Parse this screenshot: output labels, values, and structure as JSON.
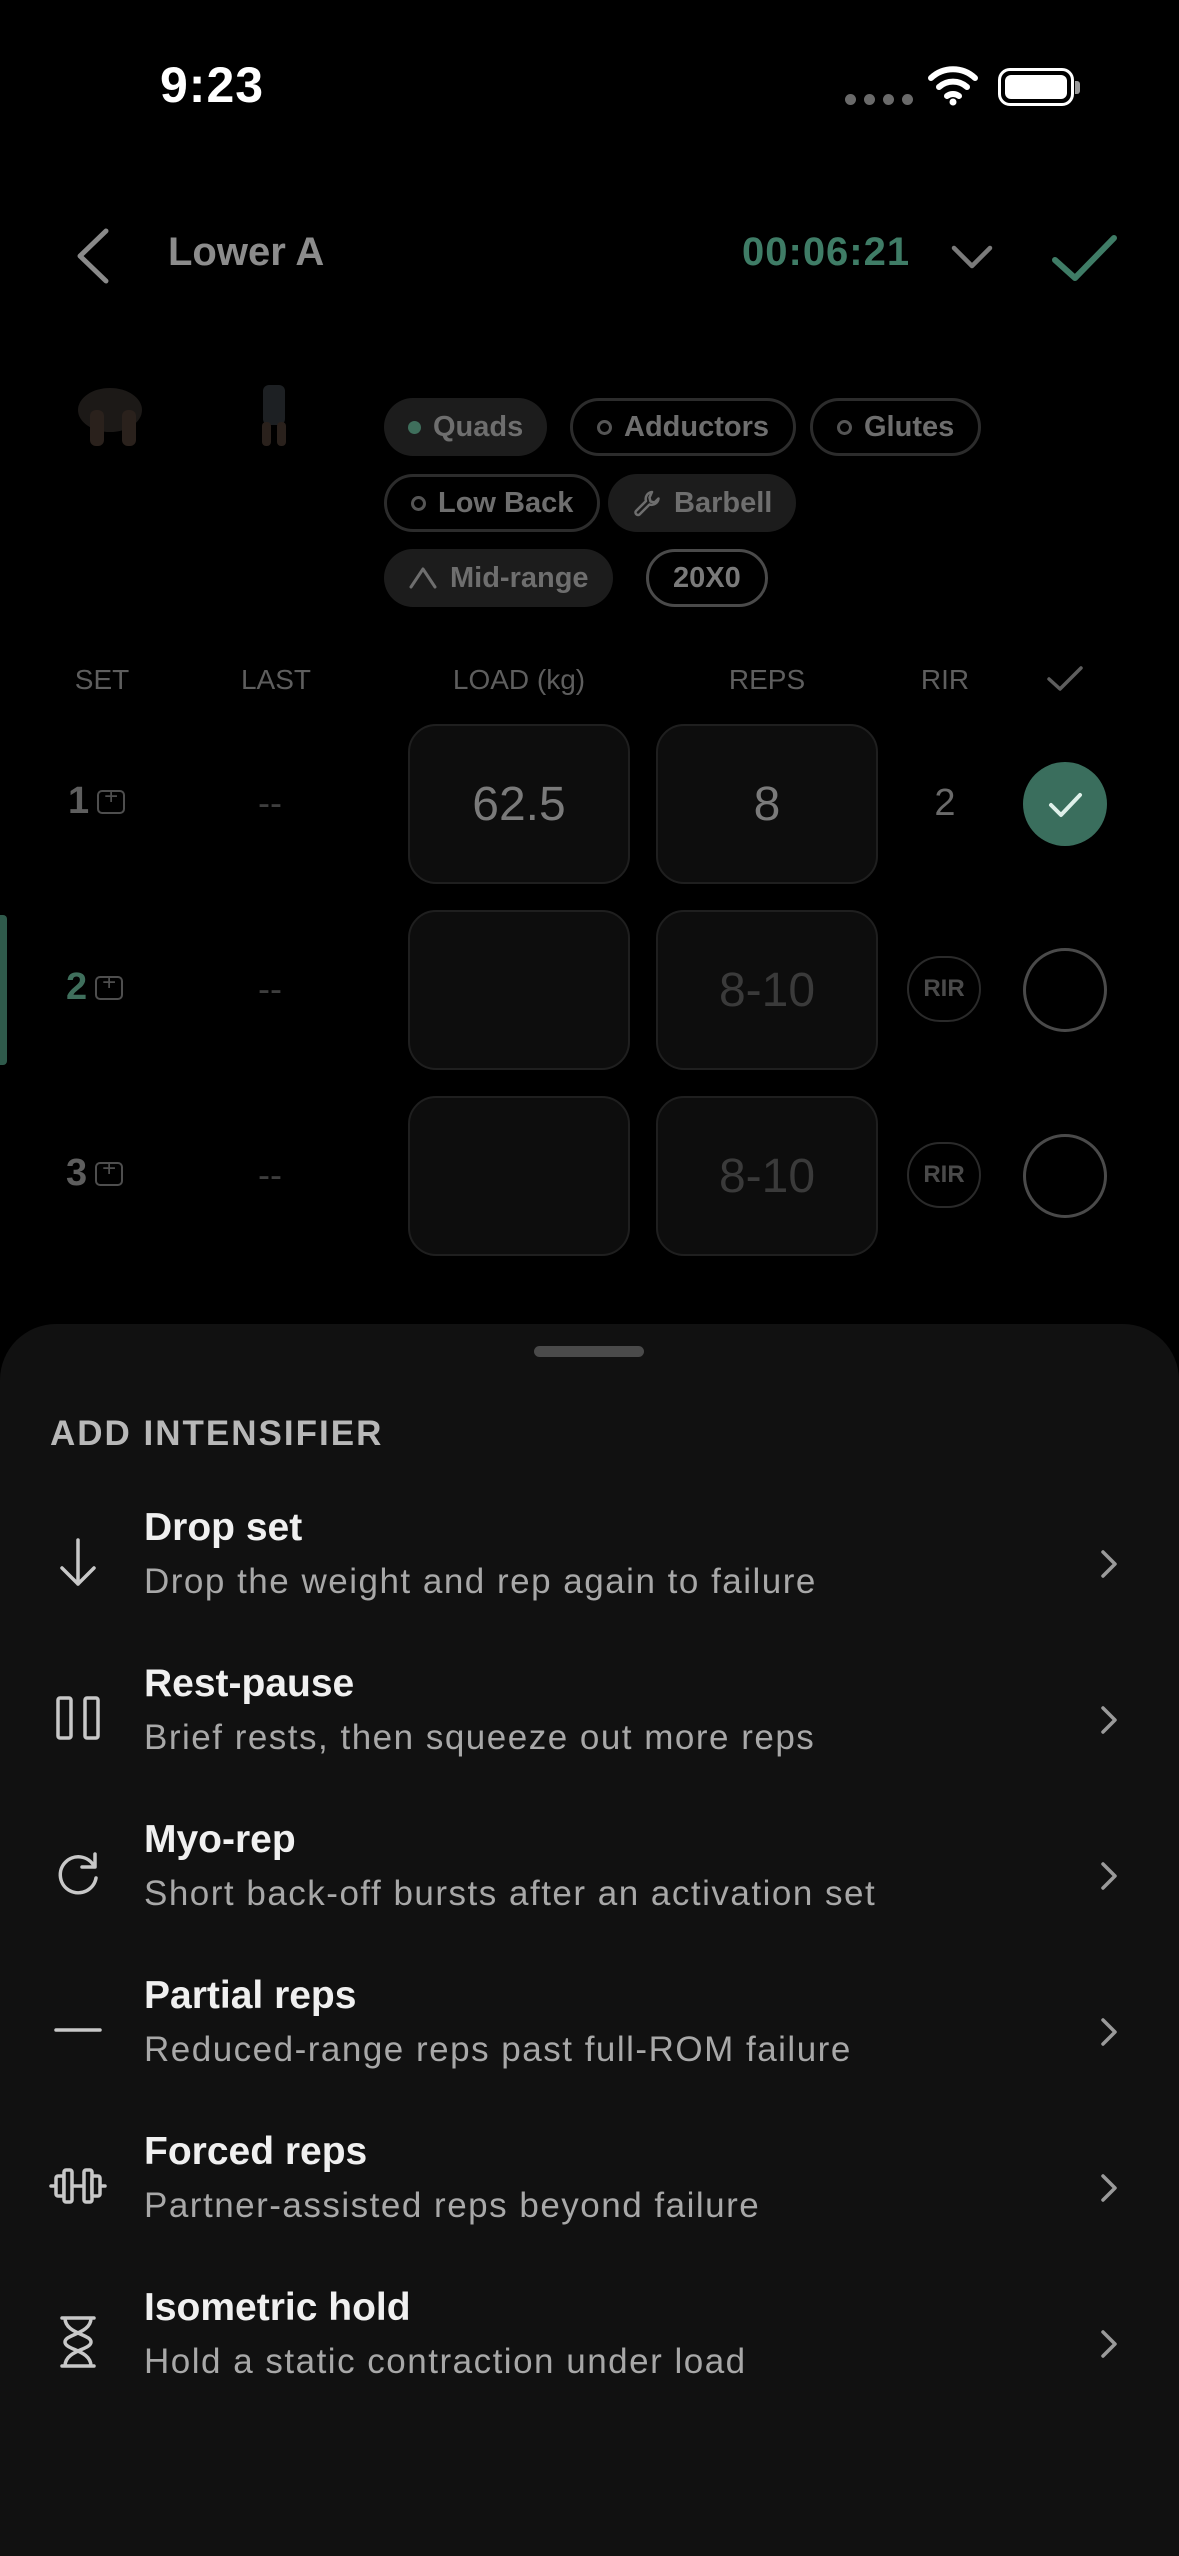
{
  "status_bar": {
    "time": "9:23"
  },
  "header": {
    "title": "Lower A",
    "timer": "00:06:21"
  },
  "exercise": {
    "tags": {
      "quads": "Quads",
      "adductors": "Adductors",
      "glutes": "Glutes",
      "low_back": "Low Back",
      "equipment": "Barbell",
      "range": "Mid-range",
      "tempo": "20X0"
    }
  },
  "table": {
    "headers": {
      "set": "SET",
      "last": "LAST",
      "load": "LOAD (kg)",
      "reps": "REPS",
      "rir": "RIR"
    },
    "rows": [
      {
        "set": "1",
        "last": "--",
        "load": "62.5",
        "reps": "8",
        "rir": "2",
        "done": true
      },
      {
        "set": "2",
        "last": "--",
        "load": "",
        "reps": "8-10",
        "rir": "RIR",
        "done": false,
        "active": true
      },
      {
        "set": "3",
        "last": "--",
        "load": "",
        "reps": "8-10",
        "rir": "RIR",
        "done": false
      }
    ]
  },
  "sheet": {
    "title": "ADD INTENSIFIER",
    "options": [
      {
        "name": "Drop set",
        "desc": "Drop the weight and rep again to failure",
        "icon": "arrow-down-icon"
      },
      {
        "name": "Rest-pause",
        "desc": "Brief rests, then squeeze out more reps",
        "icon": "pause-icon"
      },
      {
        "name": "Myo-rep",
        "desc": "Short back-off bursts after an activation set",
        "icon": "refresh-icon"
      },
      {
        "name": "Partial reps",
        "desc": "Reduced-range reps past full-ROM failure",
        "icon": "minus-icon"
      },
      {
        "name": "Forced reps",
        "desc": "Partner-assisted reps beyond failure",
        "icon": "dumbbell-icon"
      },
      {
        "name": "Isometric hold",
        "desc": "Hold a static contraction under load",
        "icon": "hourglass-icon"
      }
    ]
  },
  "colors": {
    "accent": "#3f7c66",
    "sheet_bg": "#111111",
    "background": "#000000"
  }
}
